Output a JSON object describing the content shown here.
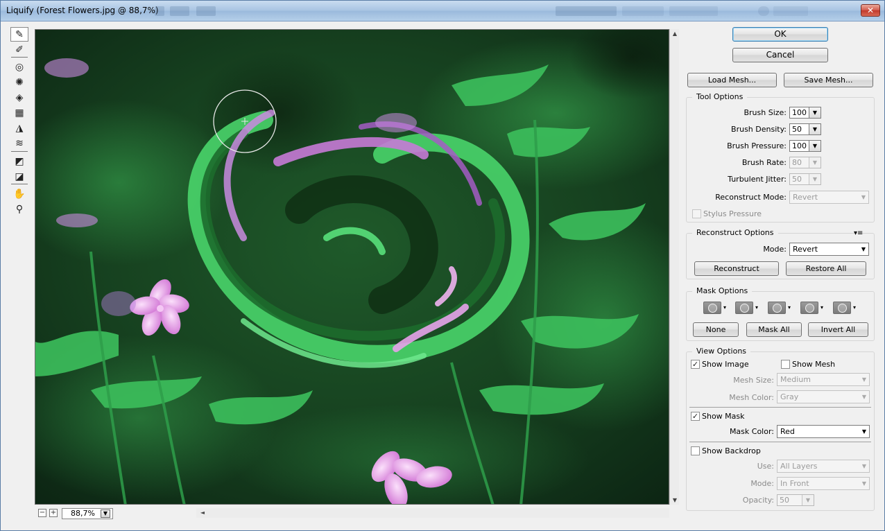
{
  "window": {
    "title": "Liquify (Forest Flowers.jpg @ 88,7%)",
    "close_glyph": "✕"
  },
  "tools": [
    {
      "icon": "forward-warp-icon",
      "glyph": "✎"
    },
    {
      "icon": "reconstruct-icon",
      "glyph": "✐"
    },
    {
      "icon": "twirl-clockwise-icon",
      "glyph": "◎"
    },
    {
      "icon": "pucker-icon",
      "glyph": "✺"
    },
    {
      "icon": "bloat-icon",
      "glyph": "◈"
    },
    {
      "icon": "push-left-icon",
      "glyph": "▦"
    },
    {
      "icon": "mirror-icon",
      "glyph": "◮"
    },
    {
      "icon": "turbulence-icon",
      "glyph": "≋"
    },
    {
      "icon": "freeze-mask-icon",
      "glyph": "◩"
    },
    {
      "icon": "thaw-mask-icon",
      "glyph": "◪"
    },
    {
      "icon": "hand-icon",
      "glyph": "✋"
    },
    {
      "icon": "zoom-icon",
      "glyph": "⚲"
    }
  ],
  "zoom": {
    "minus": "−",
    "plus": "+",
    "value": "88,7%",
    "drop": "▼"
  },
  "buttons": {
    "ok": "OK",
    "cancel": "Cancel",
    "load_mesh": "Load Mesh...",
    "save_mesh": "Save Mesh..."
  },
  "tool_options": {
    "title": "Tool Options",
    "brush_size_label": "Brush Size:",
    "brush_size": "100",
    "brush_density_label": "Brush Density:",
    "brush_density": "50",
    "brush_pressure_label": "Brush Pressure:",
    "brush_pressure": "100",
    "brush_rate_label": "Brush Rate:",
    "brush_rate": "80",
    "turbulent_jitter_label": "Turbulent Jitter:",
    "turbulent_jitter": "50",
    "reconstruct_mode_label": "Reconstruct Mode:",
    "reconstruct_mode": "Revert",
    "stylus_pressure_label": "Stylus Pressure",
    "stylus_pressure_checked": false
  },
  "reconstruct_options": {
    "title": "Reconstruct Options",
    "mode_label": "Mode:",
    "mode": "Revert",
    "reconstruct": "Reconstruct",
    "restore_all": "Restore All",
    "flyout_glyph": "▾≡"
  },
  "mask_options": {
    "title": "Mask Options",
    "none": "None",
    "mask_all": "Mask All",
    "invert_all": "Invert All"
  },
  "view_options": {
    "title": "View Options",
    "show_image_label": "Show Image",
    "show_image_checked": true,
    "show_mesh_label": "Show Mesh",
    "show_mesh_checked": false,
    "mesh_size_label": "Mesh Size:",
    "mesh_size": "Medium",
    "mesh_color_label": "Mesh Color:",
    "mesh_color": "Gray",
    "show_mask_label": "Show Mask",
    "show_mask_checked": true,
    "mask_color_label": "Mask Color:",
    "mask_color": "Red",
    "show_backdrop_label": "Show Backdrop",
    "show_backdrop_checked": false,
    "use_label": "Use:",
    "use": "All Layers",
    "mode_label": "Mode:",
    "mode": "In Front",
    "opacity_label": "Opacity:",
    "opacity": "50"
  },
  "glyphs": {
    "check": "✓",
    "down": "▼",
    "up": "▲",
    "left": "◄",
    "mask_arrow": "▾"
  },
  "colors": {
    "accent": "#3c7fb1",
    "foliage": "#2fae4c",
    "flower": "#d98ee0"
  }
}
